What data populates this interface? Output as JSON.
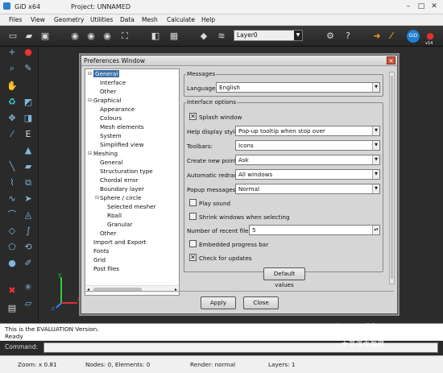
{
  "window": {
    "app_title": "GiD x64",
    "project": "Project: UNNAMED"
  },
  "menu": [
    "Files",
    "View",
    "Geometry",
    "Utilities",
    "Data",
    "Mesh",
    "Calculate",
    "Help"
  ],
  "toolbar": {
    "layer": "Layer0",
    "version_badge": "v14",
    "logo": "GiD"
  },
  "dialog": {
    "title": "Preferences Window",
    "tree": [
      "General",
      "Interface",
      "Other",
      "Graphical",
      "Appearance",
      "Colours",
      "Mesh elements",
      "System",
      "Simplified view",
      "Meshing",
      "General",
      "Structuration type",
      "Chordal error",
      "Boundary layer",
      "Sphere / circle",
      "Selected mesher",
      "Rball",
      "Granular",
      "Other",
      "Import and Export",
      "Fonts",
      "Grid",
      "Post files"
    ],
    "messages_group": "Messages",
    "language_label": "Language:",
    "language_value": "English",
    "interface_group": "Interface options",
    "splash": "Splash window",
    "help_label": "Help display style:",
    "help_value": "Pop-up tooltip when stop over",
    "toolbars_label": "Toolbars:",
    "toolbars_value": "Icons",
    "create_label": "Create new point:",
    "create_value": "Ask",
    "redraw_label": "Automatic redraw:",
    "redraw_value": "All windows",
    "popup_label": "Popup messages:",
    "popup_value": "Normal",
    "play_sound": "Play sound",
    "shrink": "Shrink windows when selecting",
    "recent_label": "Number of recent files:",
    "recent_value": "5",
    "embedded": "Embedded progress bar",
    "check_updates": "Check for updates",
    "default_btn": "Default values",
    "apply_btn": "Apply",
    "close_btn": "Close"
  },
  "status": {
    "line1": "This is the EVALUATION Version.",
    "line2": "Ready"
  },
  "command": {
    "label": "Command:"
  },
  "bottom": {
    "zoom": "Zoom: x 0.81",
    "nodes": "Nodes: 0, Elements: 0",
    "render": "Render: normal",
    "layers": "Layers: 1"
  },
  "watermark": {
    "brand": "PConline",
    "sub": "太平洋电脑网"
  }
}
